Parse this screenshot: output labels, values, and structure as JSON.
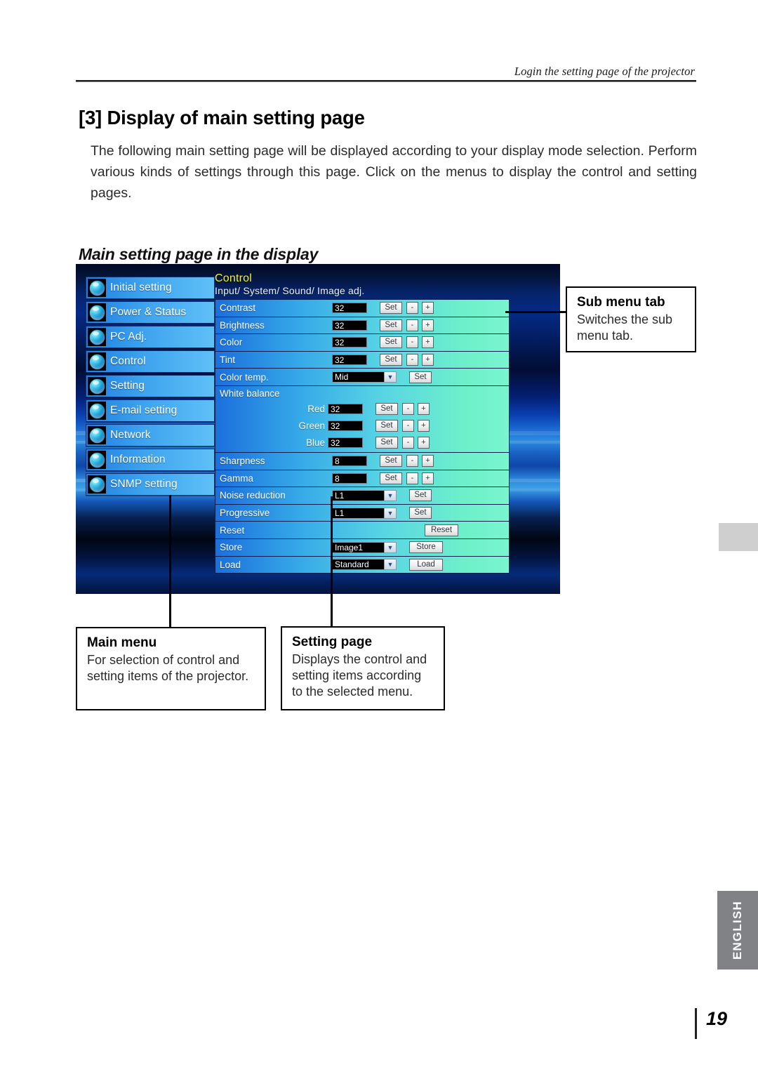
{
  "header": {
    "running_head": "Login the setting page of the projector",
    "title": "[3] Display of main setting page",
    "intro": "The following main setting page will be displayed according to your display mode selection. Perform various kinds of settings through this page. Click on the menus to display the control and setting pages.",
    "subtitle": "Main setting page in the display"
  },
  "screenshot": {
    "main_menu": [
      {
        "label": "Initial setting",
        "icon": "globe-icon"
      },
      {
        "label": "Power & Status",
        "icon": "globe-icon"
      },
      {
        "label": "PC Adj.",
        "icon": "globe-icon"
      },
      {
        "label": "Control",
        "icon": "globe-icon"
      },
      {
        "label": "Setting",
        "icon": "globe-icon"
      },
      {
        "label": "E-mail setting",
        "icon": "globe-icon"
      },
      {
        "label": "Network",
        "icon": "globe-icon"
      },
      {
        "label": "Information",
        "icon": "globe-icon"
      },
      {
        "label": "SNMP setting",
        "icon": "globe-icon"
      }
    ],
    "panel": {
      "title": "Control",
      "subtitle": "Input/ System/ Sound/ Image adj.",
      "rows": [
        {
          "name": "Contrast",
          "value": "32",
          "set": "Set",
          "minus": "-",
          "plus": "+"
        },
        {
          "name": "Brightness",
          "value": "32",
          "set": "Set",
          "minus": "-",
          "plus": "+"
        },
        {
          "name": "Color",
          "value": "32",
          "set": "Set",
          "minus": "-",
          "plus": "+"
        },
        {
          "name": "Tint",
          "value": "32",
          "set": "Set",
          "minus": "-",
          "plus": "+"
        },
        {
          "name": "Color temp.",
          "select": "Mid",
          "set": "Set"
        }
      ],
      "white_balance": {
        "name": "White balance",
        "channels": [
          {
            "label": "Red",
            "value": "32",
            "set": "Set",
            "minus": "-",
            "plus": "+"
          },
          {
            "label": "Green",
            "value": "32",
            "set": "Set",
            "minus": "-",
            "plus": "+"
          },
          {
            "label": "Blue",
            "value": "32",
            "set": "Set",
            "minus": "-",
            "plus": "+"
          }
        ]
      },
      "rows2": [
        {
          "name": "Sharpness",
          "value": "8",
          "set": "Set",
          "minus": "-",
          "plus": "+"
        },
        {
          "name": "Gamma",
          "value": "8",
          "set": "Set",
          "minus": "-",
          "plus": "+"
        }
      ],
      "rows3": [
        {
          "name": "Noise reduction",
          "select": "L1",
          "set": "Set"
        },
        {
          "name": "Progressive",
          "select": "L1",
          "set": "Set"
        },
        {
          "name": "Reset",
          "select": null,
          "set": "Reset"
        },
        {
          "name": "Store",
          "select": "Image1",
          "set": "Store"
        },
        {
          "name": "Load",
          "select": "Standard",
          "set": "Load"
        }
      ],
      "select_arrow": "▼"
    }
  },
  "callouts": {
    "sub_menu_tab": {
      "title": "Sub menu tab",
      "body": "Switches the sub menu tab."
    },
    "main_menu": {
      "title": "Main menu",
      "body": "For selection of  control and setting items of the projector."
    },
    "setting_page": {
      "title": "Setting page",
      "body": "Displays the control and setting items according to the selected menu."
    }
  },
  "footer": {
    "language_tab": "ENGLISH",
    "page_number": "19"
  },
  "colors": {
    "panel_title": "#f5f02a",
    "menu_gradient_start": "#1f7fdf",
    "menu_gradient_end": "#5fc0f7",
    "english_tab_bg": "#808285",
    "side_tab_bg": "#cfcfcf"
  }
}
